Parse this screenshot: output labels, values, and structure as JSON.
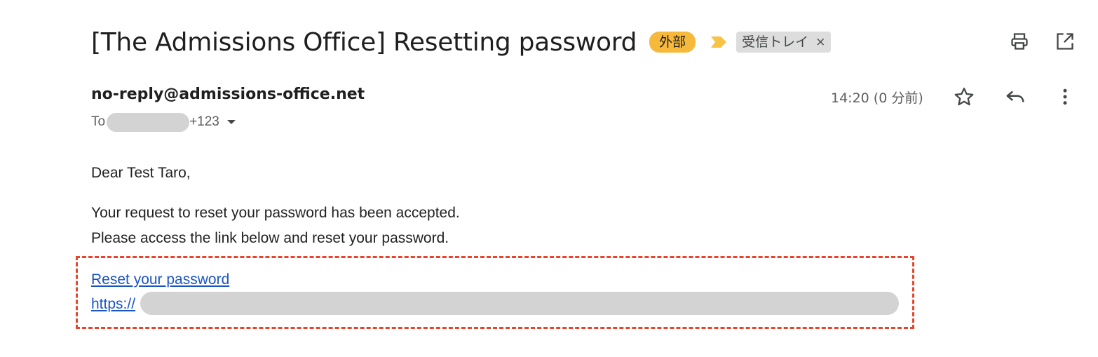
{
  "email": {
    "subject": "[The Admissions Office] Resetting password",
    "external_badge": "外部",
    "inbox_label": "受信トレイ",
    "label_remove": "×",
    "sender": "no-reply@admissions-office.net",
    "to_prefix": "To",
    "more_recipients": "+123",
    "time": "14:20 (0 分前)",
    "body": {
      "greeting": "Dear Test Taro,",
      "line1": "Your request to reset your password has been accepted.",
      "line2": "Please access the link below and reset your password.",
      "link_text": "Reset your password",
      "url_prefix": "https://"
    }
  },
  "icons": {
    "print": "print-icon",
    "open_new_window": "open-in-new-window-icon",
    "star": "star-icon",
    "reply": "reply-icon",
    "more": "more-vert-icon",
    "importance": "importance-marker-icon",
    "recipients_dropdown": "chevron-down-icon"
  },
  "colors": {
    "external_badge": "#f6b93b",
    "importance_marker": "#f6c344",
    "label_chip": "#dddddd",
    "link": "#1a55c4",
    "highlight_border": "#e8442a",
    "redaction": "#d3d3d3"
  }
}
